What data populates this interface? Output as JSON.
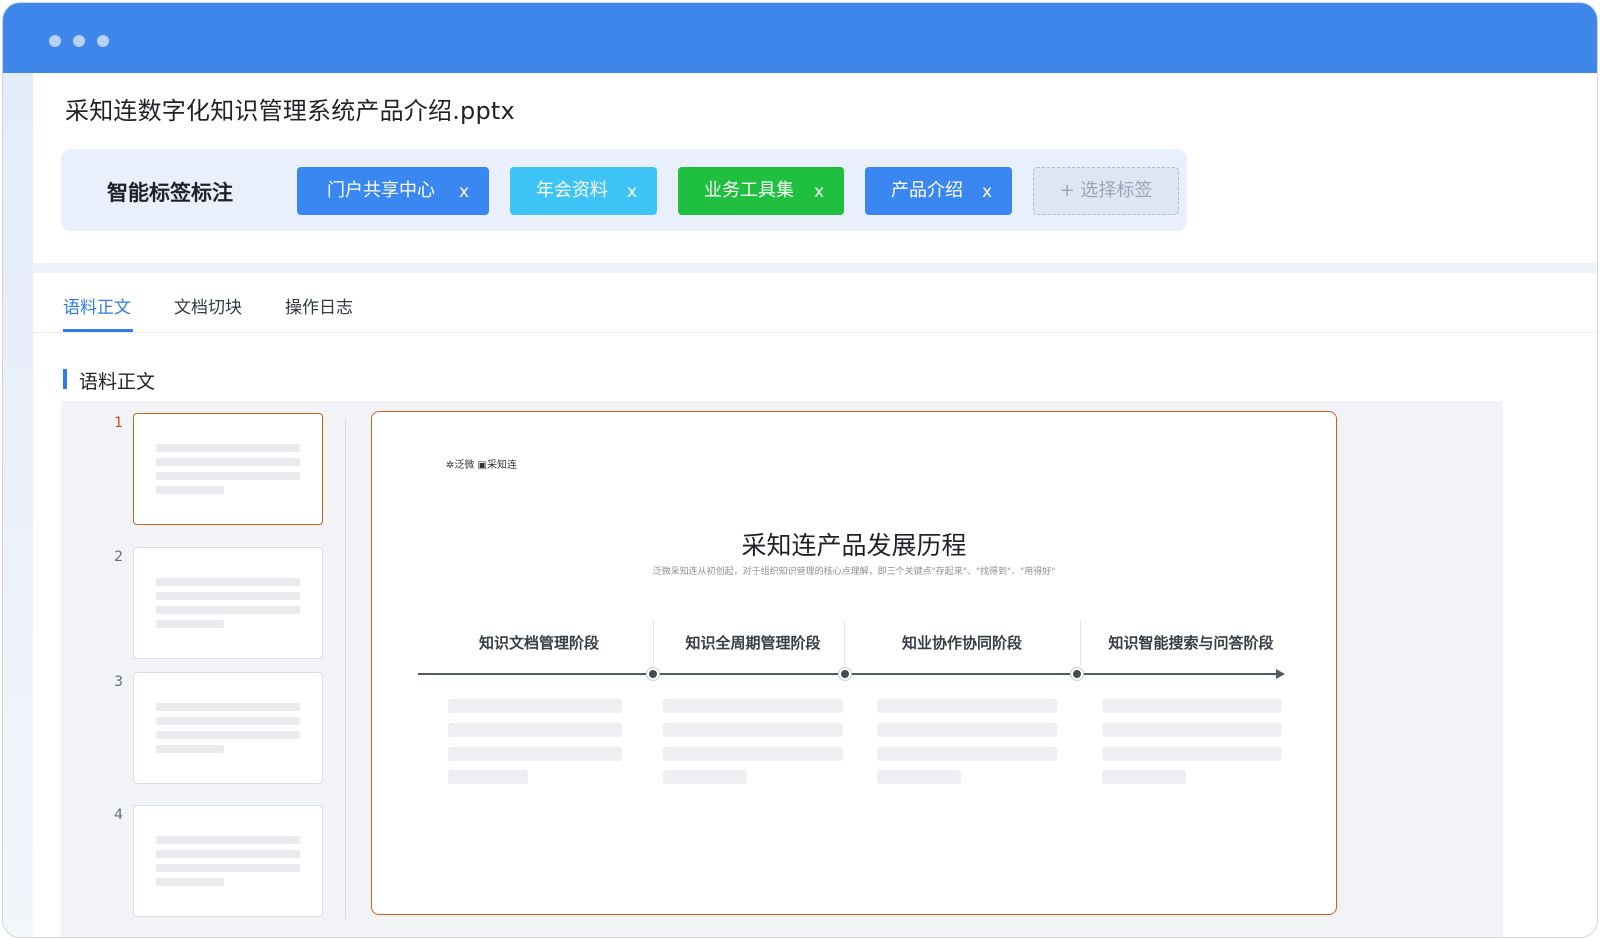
{
  "window": {
    "dots": [
      "dot",
      "dot",
      "dot"
    ]
  },
  "document": {
    "file_name": "采知连数字化知识管理系统产品介绍.pptx"
  },
  "tagging": {
    "label": "智能标签标注",
    "tags": [
      {
        "text": "门户共享中心",
        "remove": "x",
        "color": "#3b87f2"
      },
      {
        "text": "年会资料",
        "remove": "x",
        "color": "#3ec3f7"
      },
      {
        "text": "业务工具集",
        "remove": "x",
        "color": "#1fbf3f"
      },
      {
        "text": "产品介绍",
        "remove": "x",
        "color": "#3b87f2"
      }
    ],
    "add_label": "+ 选择标签"
  },
  "tabs": [
    {
      "label": "语料正文",
      "active": true
    },
    {
      "label": "文档切块",
      "active": false
    },
    {
      "label": "操作日志",
      "active": false
    }
  ],
  "section": {
    "title": "语料正文"
  },
  "thumbnails": [
    {
      "number": "1",
      "active": true
    },
    {
      "number": "2",
      "active": false
    },
    {
      "number": "3",
      "active": false
    },
    {
      "number": "4",
      "active": false
    }
  ],
  "slide": {
    "logo_text": "✲泛微 ▣采知连",
    "title": "采知连产品发展历程",
    "subtitle": "泛微采知连从初创起，对于组织知识管理的核心点理解，即三个关键点\"存起来\"、\"找得到\"、\"用得好\"",
    "phases": [
      "知识文档管理阶段",
      "知识全周期管理阶段",
      "知业协作协同阶段",
      "知识智能搜索与问答阶段"
    ]
  }
}
